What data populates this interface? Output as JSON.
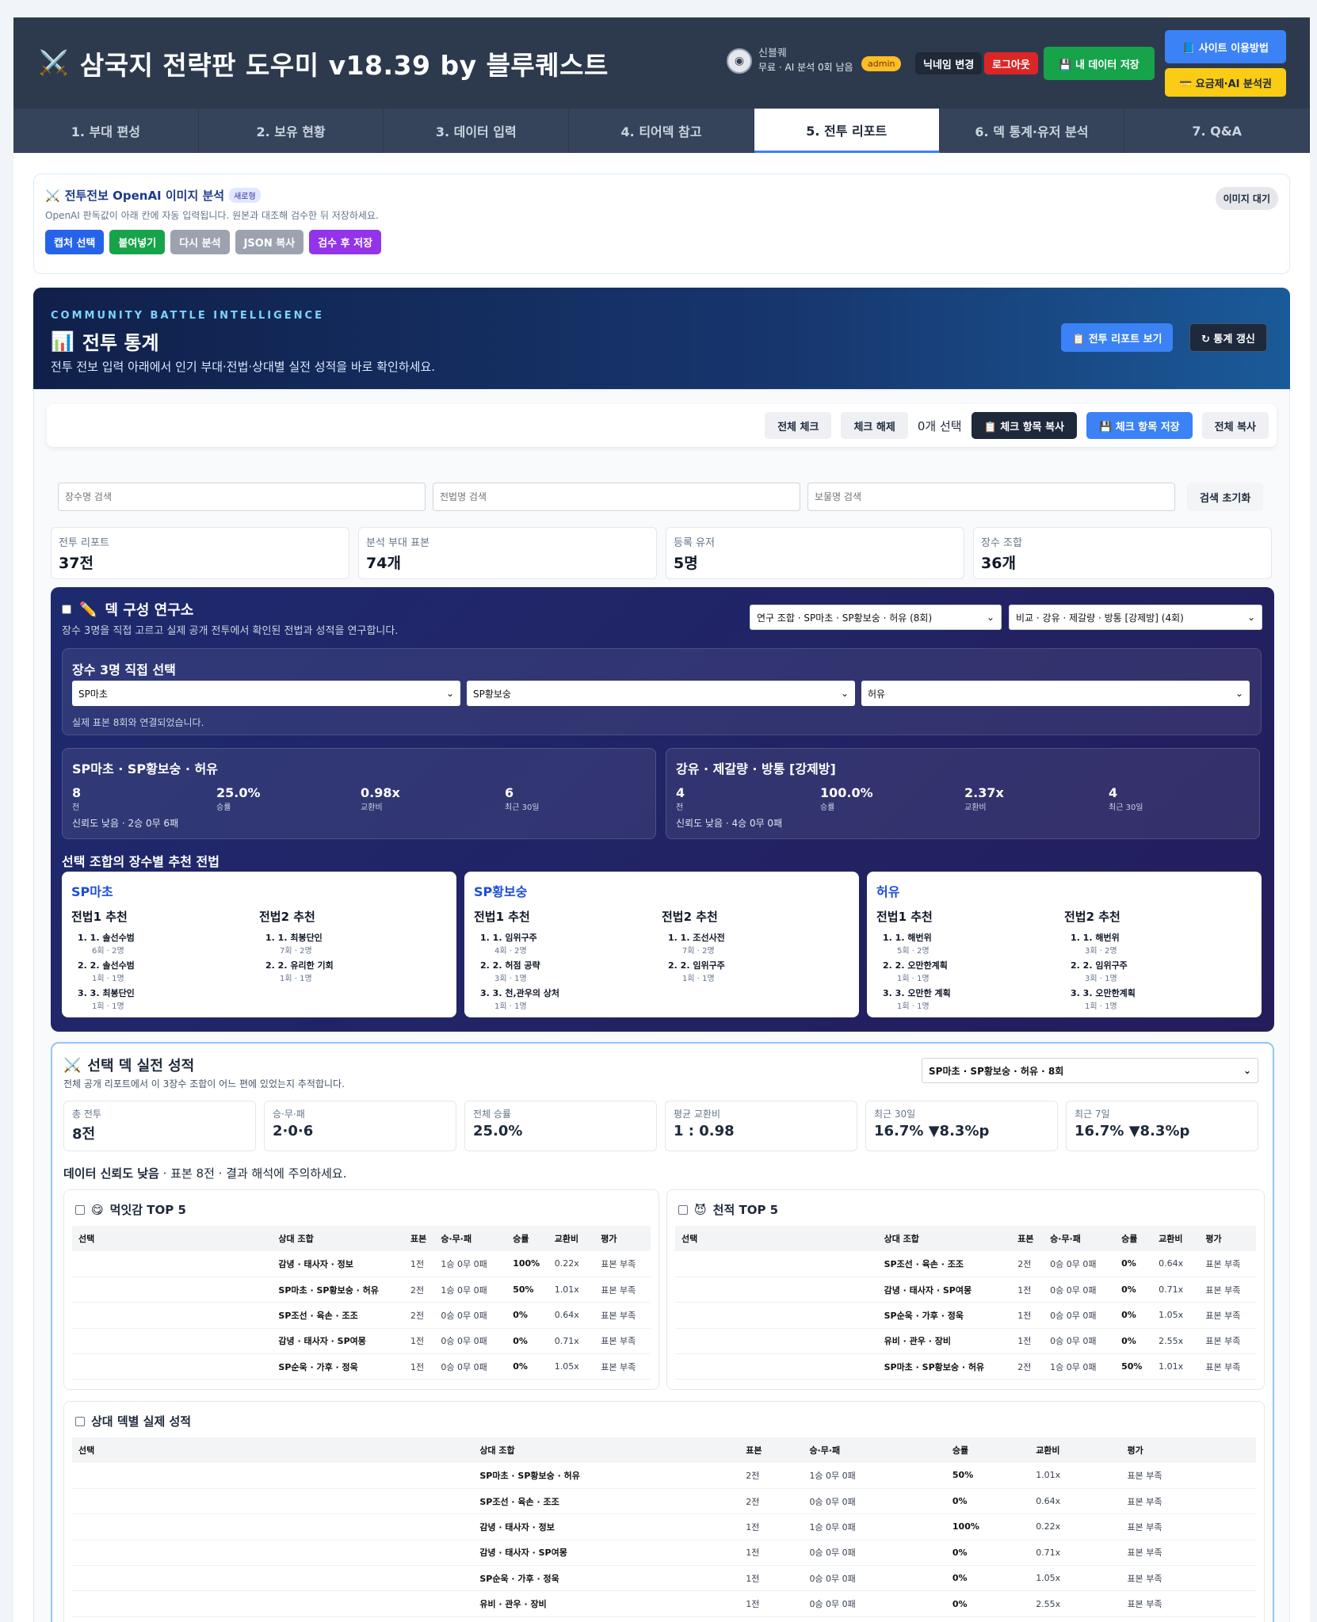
{
  "header": {
    "title": "삼국지 전략판 도우미 v18.39 by 블루퀘스트",
    "user_name": "신블퀘",
    "user_quota": "무료 · AI 분석 0회 남음",
    "admin_badge": "admin",
    "nickname_btn": "닉네임 변경",
    "logout_btn": "로그아웃",
    "save_btn": "💾 내 데이터 저장",
    "guide_btn": "📘 사이트 이용방법",
    "plan_btn": "💳 요금제·AI 분석권"
  },
  "tabs": [
    "1. 부대 편성",
    "2. 보유 현황",
    "3. 데이터 입력",
    "4. 티어덱 참고",
    "5. 전투 리포트",
    "6. 덱 통계·유저 분석",
    "7. Q&A"
  ],
  "ocr": {
    "title": "전투전보 OpenAI 이미지 분석",
    "new_badge": "새로형",
    "desc": "OpenAI 판독값이 아래 칸에 자동 입력됩니다. 원본과 대조해 검수한 뒤 저장하세요.",
    "buttons": [
      "캡처 선택",
      "붙여넣기",
      "다시 분석",
      "JSON 복사",
      "검수 후 저장"
    ],
    "status": "이미지 대기"
  },
  "hero": {
    "eyebrow": "COMMUNITY BATTLE INTELLIGENCE",
    "title": "전투 통계",
    "desc": "전투 전보 입력 아래에서 인기 부대·전법·상대별 실전 성적을 바로 확인하세요.",
    "report_btn": "📋 전투 리포트 보기",
    "refresh_btn": "↻ 통계 갱신"
  },
  "toolbar": {
    "check_all": "전체 체크",
    "uncheck": "체크 해제",
    "selected": "0개 선택",
    "copy_checked": "📋 체크 항목 복사",
    "save_checked": "💾 체크 항목 저장",
    "copy_all": "전체 복사"
  },
  "search": {
    "general": "장수명 검색",
    "tactic": "전법명 검색",
    "treasure": "보물명 검색",
    "reset": "검색 초기화"
  },
  "kpis": [
    {
      "label": "전투 리포트",
      "value": "37전"
    },
    {
      "label": "분석 부대 표본",
      "value": "74개"
    },
    {
      "label": "등록 유저",
      "value": "5명"
    },
    {
      "label": "장수 조합",
      "value": "36개"
    }
  ],
  "lab": {
    "title": "덱 구성 연구소",
    "desc": "장수 3명을 직접 고르고 실제 공개 전투에서 확인된 전법과 성적을 연구합니다.",
    "research_select": "연구 조합 · SP마초 · SP황보숭 · 허유 (8회)",
    "compare_select": "비교 · 강유 · 제갈량 · 방통 [강제방] (4회)",
    "pick_title": "장수 3명 직접 선택",
    "picks": [
      "SP마초",
      "SP황보숭",
      "허유"
    ],
    "pick_note": "실제 표본 8회와 연결되었습니다.",
    "compare": [
      {
        "name": "SP마초 · SP황보숭 · 허유",
        "metrics": [
          {
            "v": "8",
            "l": "전"
          },
          {
            "v": "25.0%",
            "l": "승률"
          },
          {
            "v": "0.98x",
            "l": "교환비"
          },
          {
            "v": "6",
            "l": "최근 30일"
          }
        ],
        "note": "신뢰도 낮음 · 2승 0무 6패"
      },
      {
        "name": "강유 · 제갈량 · 방통 [강제방]",
        "metrics": [
          {
            "v": "4",
            "l": "전"
          },
          {
            "v": "100.0%",
            "l": "승률"
          },
          {
            "v": "2.37x",
            "l": "교환비"
          },
          {
            "v": "4",
            "l": "최근 30일"
          }
        ],
        "note": "신뢰도 낮음 · 4승 0무 0패"
      }
    ],
    "rec_title": "선택 조합의 장수별 추천 전법",
    "recs": [
      {
        "name": "SP마초",
        "col1_h": "전법1 추천",
        "col1": [
          {
            "t": "1. 1. 솔선수범",
            "s": "6회 · 2명"
          },
          {
            "t": "2. 2. 솔선수범",
            "s": "1회 · 1명"
          },
          {
            "t": "3. 3. 최봉단인",
            "s": "1회 · 1명"
          }
        ],
        "col2_h": "전법2 추천",
        "col2": [
          {
            "t": "1. 1. 최봉단인",
            "s": "7회 · 2명"
          },
          {
            "t": "2. 2. 유리한 기회",
            "s": "1회 · 1명"
          }
        ]
      },
      {
        "name": "SP황보숭",
        "col1_h": "전법1 추천",
        "col1": [
          {
            "t": "1. 1. 임위구주",
            "s": "4회 · 2명"
          },
          {
            "t": "2. 2. 허점 공략",
            "s": "3회 · 1명"
          },
          {
            "t": "3. 3. 천,관우의 상처",
            "s": "1회 · 1명"
          }
        ],
        "col2_h": "전법2 추천",
        "col2": [
          {
            "t": "1. 1. 조선사전",
            "s": "7회 · 2명"
          },
          {
            "t": "2. 2. 임위구주",
            "s": "1회 · 1명"
          }
        ]
      },
      {
        "name": "허유",
        "col1_h": "전법1 추천",
        "col1": [
          {
            "t": "1. 1. 해번위",
            "s": "5회 · 2명"
          },
          {
            "t": "2. 2. 오만한계획",
            "s": "1회 · 1명"
          },
          {
            "t": "3. 3. 오만한 계획",
            "s": "1회 · 1명"
          }
        ],
        "col2_h": "전법2 추천",
        "col2": [
          {
            "t": "1. 1. 해번위",
            "s": "3회 · 2명"
          },
          {
            "t": "2. 2. 임위구주",
            "s": "3회 · 1명"
          },
          {
            "t": "3. 3. 오만한계획",
            "s": "1회 · 1명"
          }
        ]
      }
    ]
  },
  "deck": {
    "title": "선택 덱 실전 성적",
    "desc": "전체 공개 리포트에서 이 3장수 조합이 어느 편에 있었는지 추적합니다.",
    "select": "SP마초 · SP황보숭 · 허유 · 8회",
    "kpis": [
      {
        "label": "총 전투",
        "value": "8전"
      },
      {
        "label": "승·무·패",
        "value": "2·0·6"
      },
      {
        "label": "전체 승률",
        "value": "25.0%"
      },
      {
        "label": "평균 교환비",
        "value": "1 : 0.98"
      },
      {
        "label": "최근 30일",
        "value": "16.7% ▼8.3%p"
      },
      {
        "label": "최근 7일",
        "value": "16.7% ▼8.3%p"
      }
    ],
    "conf_bold": "데이터 신뢰도 낮음",
    "conf_rest": " · 표본 8전 · 결과 해석에 주의하세요.",
    "headers": [
      "선택",
      "상대 조합",
      "표본",
      "승·무·패",
      "승률",
      "교환비",
      "평가"
    ],
    "prey_title": "먹잇감 TOP 5",
    "prey": [
      [
        "",
        "감녕 · 태사자 · 정보",
        "1전",
        "1승 0무 0패",
        "100%",
        "0.22x",
        "표본 부족"
      ],
      [
        "",
        "SP마초 · SP황보숭 · 허유",
        "2전",
        "1승 0무 0패",
        "50%",
        "1.01x",
        "표본 부족"
      ],
      [
        "",
        "SP조선 · 육손 · 조조",
        "2전",
        "0승 0무 0패",
        "0%",
        "0.64x",
        "표본 부족"
      ],
      [
        "",
        "감녕 · 태사자 · SP여몽",
        "1전",
        "0승 0무 0패",
        "0%",
        "0.71x",
        "표본 부족"
      ],
      [
        "",
        "SP순욱 · 가후 · 정욱",
        "1전",
        "0승 0무 0패",
        "0%",
        "1.05x",
        "표본 부족"
      ]
    ],
    "nemesis_title": "천적 TOP 5",
    "nemesis": [
      [
        "",
        "SP조선 · 육손 · 조조",
        "2전",
        "0승 0무 0패",
        "0%",
        "0.64x",
        "표본 부족"
      ],
      [
        "",
        "감녕 · 태사자 · SP여몽",
        "1전",
        "0승 0무 0패",
        "0%",
        "0.71x",
        "표본 부족"
      ],
      [
        "",
        "SP순욱 · 가후 · 정욱",
        "1전",
        "0승 0무 0패",
        "0%",
        "1.05x",
        "표본 부족"
      ],
      [
        "",
        "유비 · 관우 · 장비",
        "1전",
        "0승 0무 0패",
        "0%",
        "2.55x",
        "표본 부족"
      ],
      [
        "",
        "SP마초 · SP황보숭 · 허유",
        "2전",
        "1승 0무 0패",
        "50%",
        "1.01x",
        "표본 부족"
      ]
    ],
    "opp_title": "상대 덱별 실제 성적",
    "opp": [
      [
        "",
        "SP마초 · SP황보숭 · 허유",
        "2전",
        "1승 0무 0패",
        "50%",
        "1.01x",
        "표본 부족"
      ],
      [
        "",
        "SP조선 · 육손 · 조조",
        "2전",
        "0승 0무 0패",
        "0%",
        "0.64x",
        "표본 부족"
      ],
      [
        "",
        "감녕 · 태사자 · 정보",
        "1전",
        "1승 0무 0패",
        "100%",
        "0.22x",
        "표본 부족"
      ],
      [
        "",
        "감녕 · 태사자 · SP여몽",
        "1전",
        "0승 0무 0패",
        "0%",
        "0.71x",
        "표본 부족"
      ],
      [
        "",
        "SP순욱 · 가후 · 정욱",
        "1전",
        "0승 0무 0패",
        "0%",
        "1.05x",
        "표본 부족"
      ],
      [
        "",
        "유비 · 관우 · 장비",
        "1전",
        "0승 0무 0패",
        "0%",
        "2.55x",
        "표본 부족"
      ]
    ]
  }
}
